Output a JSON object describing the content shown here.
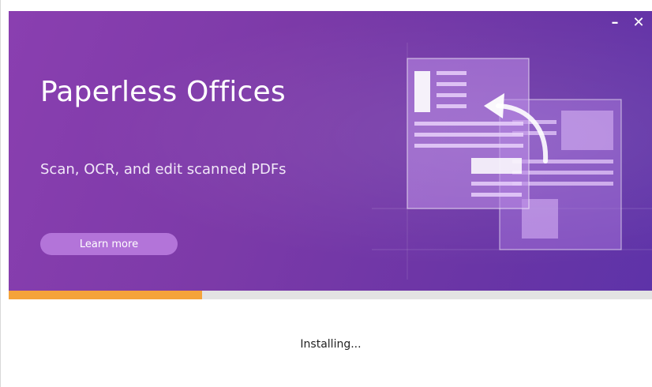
{
  "banner": {
    "title": "Paperless Offices",
    "subtitle": "Scan, OCR, and edit scanned PDFs",
    "learn_more_label": "Learn more"
  },
  "window_controls": {
    "minimize_label": "–",
    "close_label": "✕"
  },
  "progress": {
    "value": 0.3,
    "fill_color": "#f5a33a",
    "track_color": "#e3e3e3"
  },
  "status": {
    "text": "Installing..."
  },
  "icons": {
    "illustration": "document-convert-icon"
  },
  "colors": {
    "banner_start": "#8a3fb0",
    "banner_end": "#5e33a8",
    "button": "#b374d9"
  }
}
